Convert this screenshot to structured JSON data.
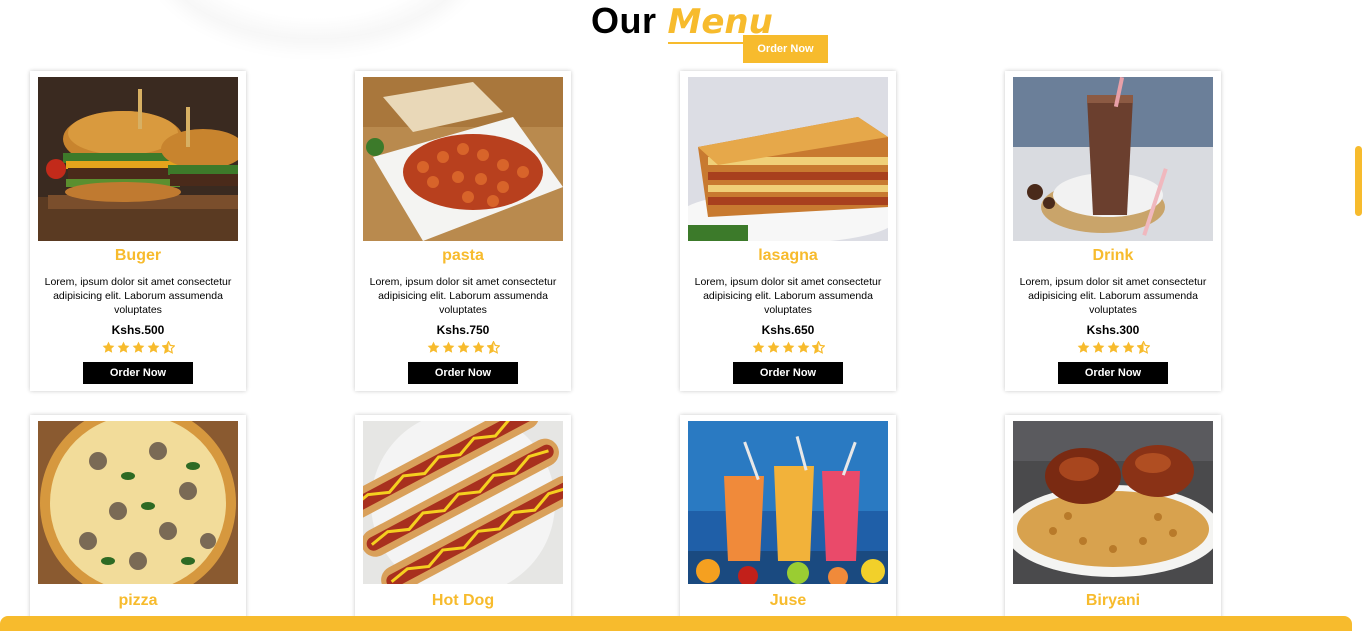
{
  "section": {
    "title_main": "Our",
    "title_accent": "Menu",
    "order_now_label": "Order Now"
  },
  "colors": {
    "accent": "#f7bb2d",
    "button_dark": "#000000",
    "text": "#000000"
  },
  "menu": {
    "items": [
      {
        "name": "Buger",
        "description": "Lorem, ipsum dolor sit amet consectetur adipisicing elit. Laborum assumenda voluptates",
        "price": "Kshs.500",
        "rating": 4.5,
        "button": "Order Now",
        "image": "burger-photo"
      },
      {
        "name": "pasta",
        "description": "Lorem, ipsum dolor sit amet consectetur adipisicing elit. Laborum assumenda voluptates",
        "price": "Kshs.750",
        "rating": 4.5,
        "button": "Order Now",
        "image": "pasta-photo"
      },
      {
        "name": "lasagna",
        "description": "Lorem, ipsum dolor sit amet consectetur adipisicing elit. Laborum assumenda voluptates",
        "price": "Kshs.650",
        "rating": 4.5,
        "button": "Order Now",
        "image": "lasagna-photo"
      },
      {
        "name": "Drink",
        "description": "Lorem, ipsum dolor sit amet consectetur adipisicing elit. Laborum assumenda voluptates",
        "price": "Kshs.300",
        "rating": 4.5,
        "button": "Order Now",
        "image": "drink-photo"
      },
      {
        "name": "pizza",
        "image": "pizza-photo"
      },
      {
        "name": "Hot Dog",
        "image": "hotdog-photo"
      },
      {
        "name": "Juse",
        "image": "juice-photo"
      },
      {
        "name": "Biryani",
        "image": "biryani-photo"
      }
    ]
  }
}
